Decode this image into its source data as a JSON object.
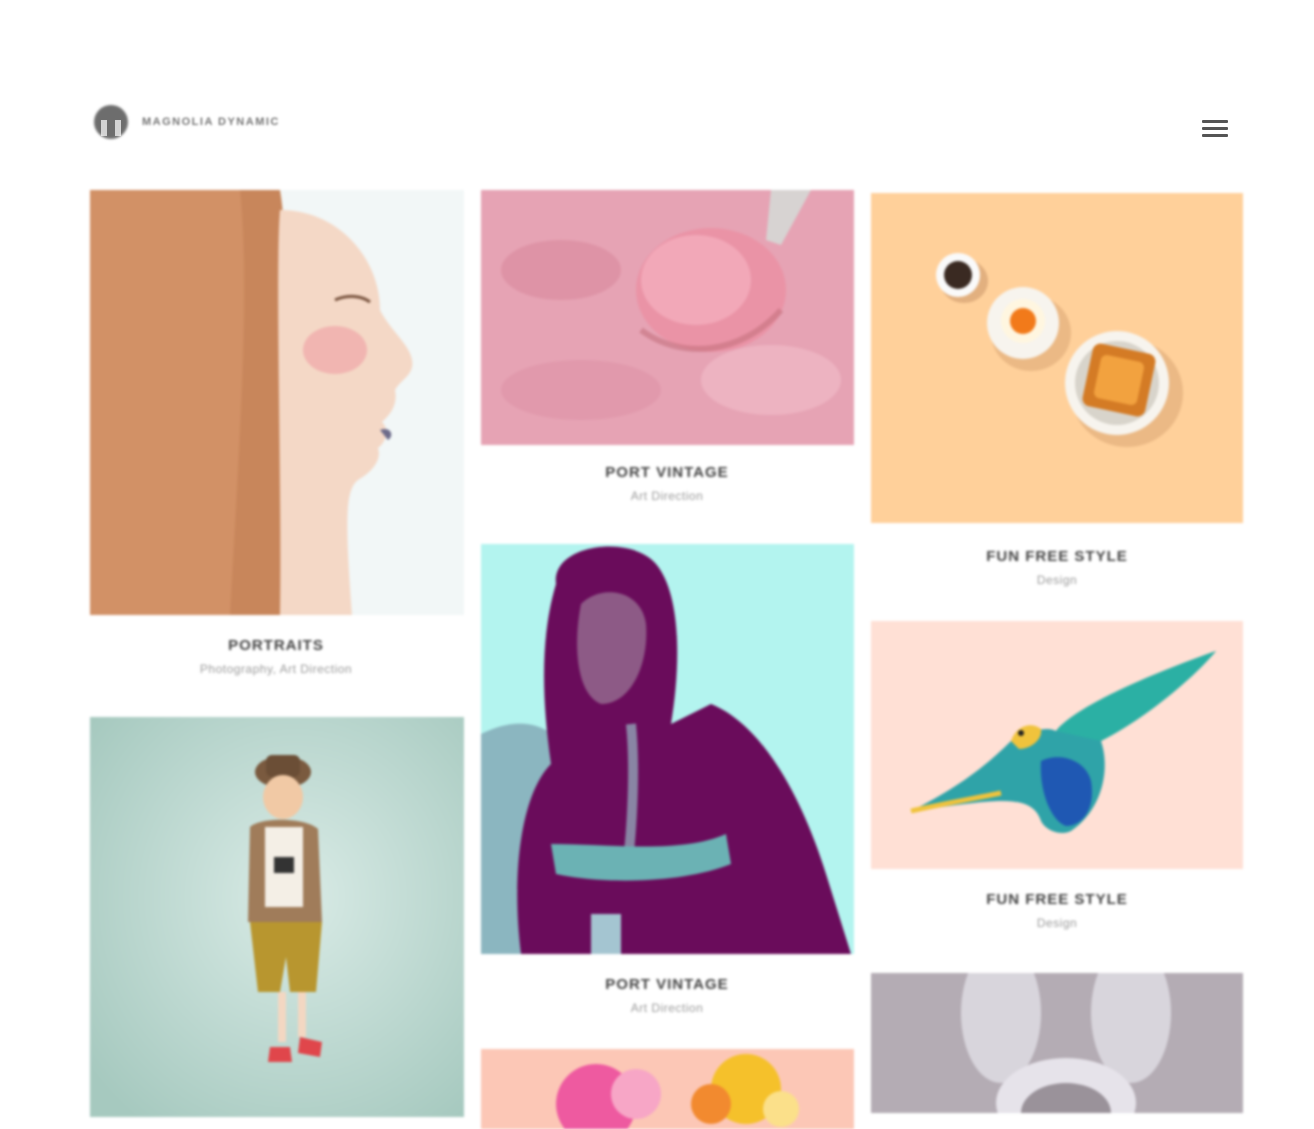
{
  "brand": {
    "name": "MAGNOLIA DYNAMIC",
    "logo_icon": "dragon-head-icon"
  },
  "header": {
    "menu_icon": "hamburger-menu-icon"
  },
  "portfolio": {
    "items": [
      {
        "title": "PORTRAITS",
        "category": "Photography, Art Direction",
        "image": "woman-profile-portrait"
      },
      {
        "title": "",
        "category": "",
        "image": "child-with-hat-camera"
      },
      {
        "title": "PORT VINTAGE",
        "category": "Art Direction",
        "image": "pink-ice-cream-spoon"
      },
      {
        "title": "PORT VINTAGE",
        "category": "Art Direction",
        "image": "woman-duotone-teal-purple"
      },
      {
        "title": "",
        "category": "",
        "image": "flowers-on-peach"
      },
      {
        "title": "FUN FREE STYLE",
        "category": "Design",
        "image": "egg-coffee-toast-breakfast"
      },
      {
        "title": "FUN FREE STYLE",
        "category": "Design",
        "image": "flying-parrot"
      },
      {
        "title": "",
        "category": "",
        "image": "woman-bunny-ears"
      }
    ]
  },
  "colors": {
    "peach_bg": "#ffd09a",
    "pink_bg": "#e7a3b4",
    "teal_bg": "#b3f4ef",
    "purple": "#6a0c5b",
    "parrot_bg": "#ffe0d5",
    "mint_bg": "#b9d6ce",
    "gray_bg": "#b4acb4"
  }
}
